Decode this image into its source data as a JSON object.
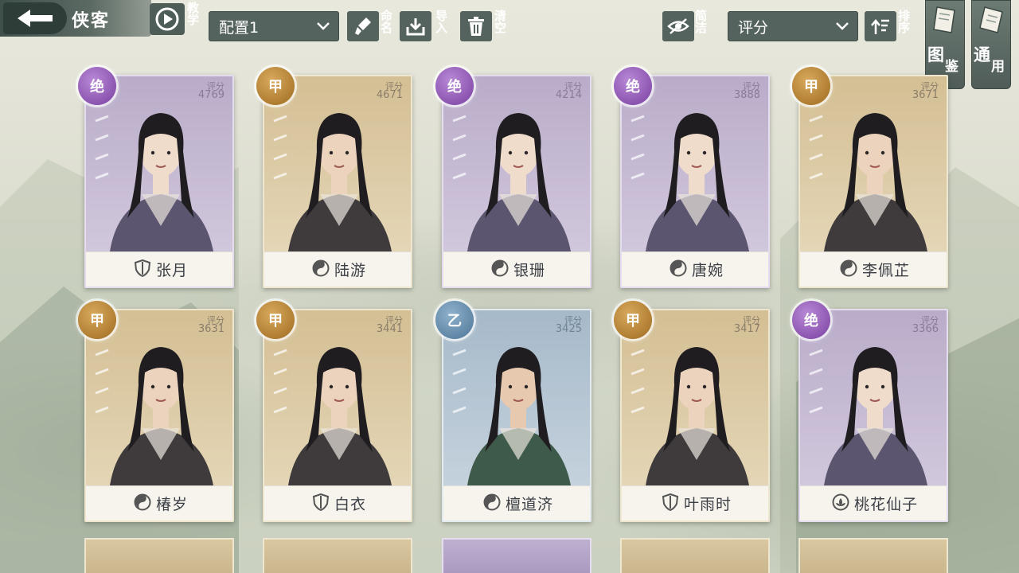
{
  "header": {
    "title": "侠客",
    "tutorial_label": "教学",
    "config_select": "配置1",
    "rename_label": "命名",
    "import_label": "导入",
    "clear_label": "清空",
    "simple_label": "简洁",
    "sort_select": "评分",
    "sort_label": "排序",
    "gallery_label_1": "图",
    "gallery_label_2": "鉴",
    "general_label_1": "通",
    "general_label_2": "用"
  },
  "cards": [
    {
      "grade": "绝",
      "tier": "purple",
      "score_label": "评分",
      "score": "4769",
      "name": "张月",
      "school_icon": "shield-icon"
    },
    {
      "grade": "甲",
      "tier": "gold",
      "score_label": "评分",
      "score": "4671",
      "name": "陆游",
      "school_icon": "yin-yang-icon"
    },
    {
      "grade": "绝",
      "tier": "purple",
      "score_label": "评分",
      "score": "4214",
      "name": "银珊",
      "school_icon": "yin-yang-icon"
    },
    {
      "grade": "绝",
      "tier": "purple",
      "score_label": "评分",
      "score": "3888",
      "name": "唐婉",
      "school_icon": "yin-yang-icon"
    },
    {
      "grade": "甲",
      "tier": "gold",
      "score_label": "评分",
      "score": "3671",
      "name": "李佩芷",
      "school_icon": "yin-yang-icon"
    },
    {
      "grade": "甲",
      "tier": "gold",
      "score_label": "评分",
      "score": "3631",
      "name": "椿岁",
      "school_icon": "yin-yang-icon"
    },
    {
      "grade": "甲",
      "tier": "gold",
      "score_label": "评分",
      "score": "3441",
      "name": "白衣",
      "school_icon": "shield-icon"
    },
    {
      "grade": "乙",
      "tier": "blue",
      "score_label": "评分",
      "score": "3425",
      "name": "檀道济",
      "school_icon": "yin-yang-icon"
    },
    {
      "grade": "甲",
      "tier": "gold",
      "score_label": "评分",
      "score": "3417",
      "name": "叶雨时",
      "school_icon": "shield-icon"
    },
    {
      "grade": "绝",
      "tier": "purple",
      "score_label": "评分",
      "score": "3366",
      "name": "桃花仙子",
      "school_icon": "lotus-icon"
    }
  ],
  "colors": {
    "accent": "#55635e",
    "purple_tier": "#7a3fa1",
    "gold_tier": "#9e6b20",
    "blue_tier": "#4c7597"
  }
}
